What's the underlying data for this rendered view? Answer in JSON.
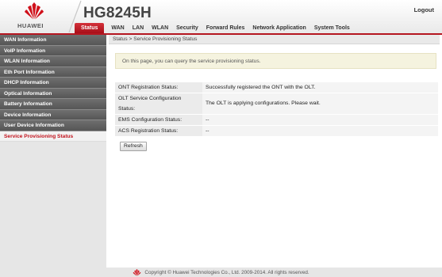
{
  "header": {
    "brand_name": "HUAWEI",
    "model": "HG8245H",
    "logout_label": "Logout"
  },
  "nav": {
    "items": [
      {
        "label": "Status",
        "active": true
      },
      {
        "label": "WAN"
      },
      {
        "label": "LAN"
      },
      {
        "label": "WLAN"
      },
      {
        "label": "Security"
      },
      {
        "label": "Forward Rules"
      },
      {
        "label": "Network Application"
      },
      {
        "label": "System Tools"
      }
    ]
  },
  "sidebar": {
    "items": [
      {
        "label": "WAN Information"
      },
      {
        "label": "VoIP Information"
      },
      {
        "label": "WLAN Information"
      },
      {
        "label": "Eth Port Information"
      },
      {
        "label": "DHCP Information"
      },
      {
        "label": "Optical Information"
      },
      {
        "label": "Battery Information"
      },
      {
        "label": "Device Information"
      },
      {
        "label": "User Device Information"
      },
      {
        "label": "Service Provisioning Status",
        "active": true
      }
    ]
  },
  "main": {
    "breadcrumb": "Status > Service Provisioning Status",
    "info_text": "On this page, you can query the service provisioning status.",
    "rows": [
      {
        "label": "ONT Registration Status:",
        "value": "Successfully registered the ONT with the OLT."
      },
      {
        "label": "OLT Service Configuration Status:",
        "value": "The OLT is applying configurations. Please wait."
      },
      {
        "label": "EMS Configuration Status:",
        "value": "--"
      },
      {
        "label": "ACS Registration Status:",
        "value": "--"
      }
    ],
    "refresh_label": "Refresh"
  },
  "footer": {
    "copyright": "Copyright © Huawei Technologies Co., Ltd. 2009-2014. All rights reserved."
  },
  "colors": {
    "accent_red": "#c1121c",
    "sidebar_dark": "#5f5f5f",
    "info_background": "#f5f3df"
  },
  "icons": {
    "brand_logo": "huawei-petal-logo",
    "footer_logo": "huawei-petal-logo"
  }
}
